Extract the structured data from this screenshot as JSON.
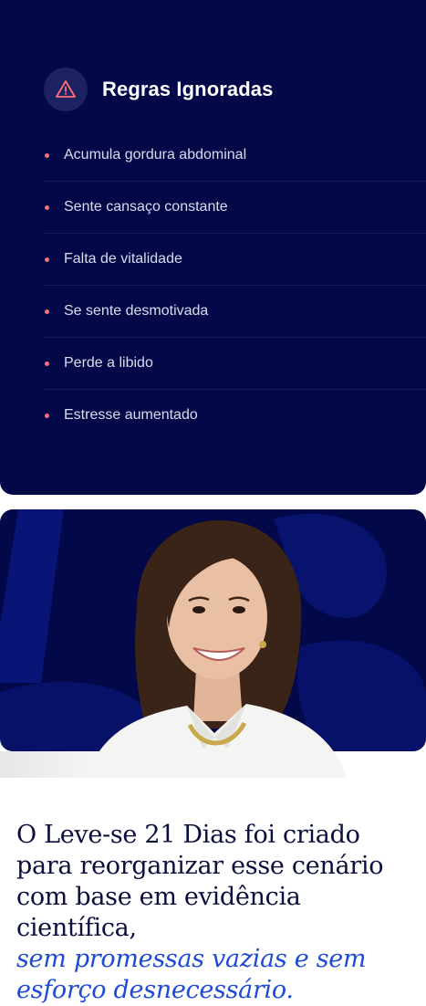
{
  "card": {
    "title": "Regras Ignoradas",
    "icon": "warning-triangle-icon",
    "accent_color": "#ff6f78",
    "background_color": "#020848",
    "items": [
      "Acumula gordura abdominal",
      "Sente cansaço constante",
      "Falta de vitalidade",
      "Se sente desmotivada",
      "Perde a libido",
      "Estresse aumentado"
    ]
  },
  "photo": {
    "subject": "portrait-woman-smiling",
    "background_color": "#020848"
  },
  "headline": {
    "text": "O Leve-se 21 Dias foi criado para reorganizar esse cenário com base em evidência científica,",
    "highlight": "sem promessas vazias e sem esforço desnecessário.",
    "highlight_color": "#1e4bd2"
  }
}
